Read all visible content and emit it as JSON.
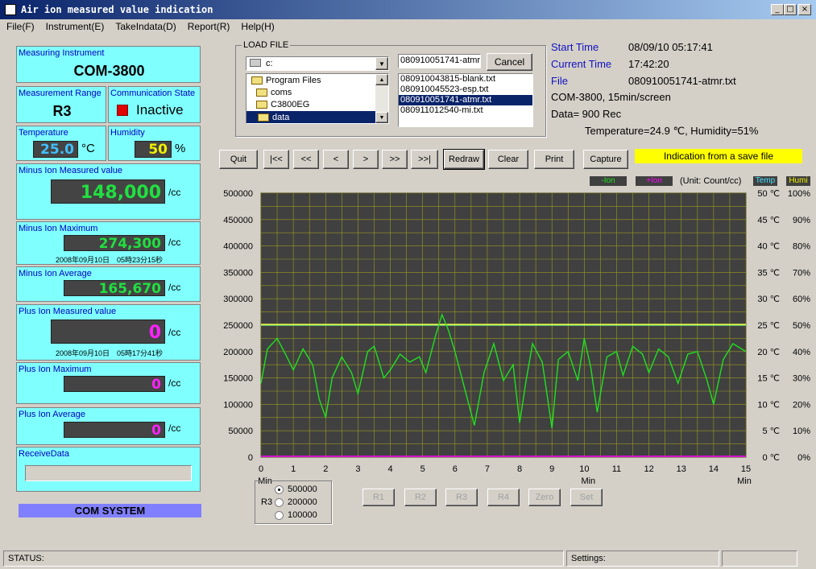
{
  "window": {
    "title": "Air ion measured value indication"
  },
  "menu": [
    "File(F)",
    "Instrument(E)",
    "TakeIndata(D)",
    "Report(R)",
    "Help(H)"
  ],
  "left": {
    "instrument_label": "Measuring Instrument",
    "instrument": "COM-3800",
    "range_label": "Measurement Range",
    "range": "R3",
    "comm_label": "Communication State",
    "comm_state": "Inactive",
    "temp_label": "Temperature",
    "temp_value": "25.0",
    "temp_unit": "°C",
    "hum_label": "Humidity",
    "hum_value": "50",
    "hum_unit": "%",
    "minus_measured_label": "Minus Ion Measured value",
    "minus_measured": "148,000",
    "minus_max_label": "Minus Ion Maximum",
    "minus_max": "274,300",
    "minus_max_time": "2008年09月10日　05時23分15秒",
    "minus_avg_label": "Minus Ion Average",
    "minus_avg": "165,670",
    "plus_measured_label": "Plus Ion Measured value",
    "plus_measured": "0",
    "plus_measured_time": "2008年09月10日　05時17分41秒",
    "plus_max_label": "Plus Ion Maximum",
    "plus_max": "0",
    "plus_avg_label": "Plus Ion Average",
    "plus_avg": "0",
    "unit": "/cc",
    "receive_label": "ReceiveData",
    "com_system": "COM SYSTEM"
  },
  "loadfile": {
    "legend": "LOAD FILE",
    "drive": "c:",
    "folders": [
      "Program Files",
      "coms",
      "C3800EG",
      "data"
    ],
    "filename_value": "080910051741-atmr.",
    "cancel": "Cancel",
    "files": [
      "080910043815-blank.txt",
      "080910045523-esp.txt",
      "080910051741-atmr.txt",
      "080911012540-mi.txt"
    ]
  },
  "info": {
    "start_label": "Start Time",
    "start": "08/09/10 05:17:41",
    "current_label": "Current Time",
    "current": "17:42:20",
    "file_label": "File",
    "file": "080910051741-atmr.txt",
    "model": "COM-3800, 15min/screen",
    "data": "Data= 900 Rec",
    "templine": "Temperature=24.9 ℃, Humidity=51%"
  },
  "toolbar": [
    "Quit",
    "|<<",
    "<<",
    "<",
    ">",
    ">>",
    ">>|",
    "Redraw",
    "Clear",
    "Print",
    "Capture"
  ],
  "indication": "Indication from a save file",
  "legend": {
    "minus": "-Ion",
    "plus": "+Ion",
    "unit": "(Unit: Count/cc)",
    "temp": "Temp",
    "humi": "Humi"
  },
  "range_group": {
    "label": "R3",
    "options": [
      "500000",
      "200000",
      "100000"
    ],
    "selected": 0
  },
  "range_buttons": [
    "R1",
    "R2",
    "R3",
    "R4",
    "Zero",
    "Set"
  ],
  "status": {
    "status_label": "STATUS:",
    "settings_label": "Settings:"
  },
  "colors": {
    "minus": "#20e020",
    "plus": "#ff00ff",
    "temp": "#ffff40",
    "hum": "#80ff80",
    "bg": "#404040",
    "grid": "#9a9a20"
  },
  "chart_data": {
    "type": "line",
    "xlabel": "Min",
    "xlim": [
      0,
      15
    ],
    "ylim": [
      0,
      500000
    ],
    "yticks": [
      "500000",
      "450000",
      "400000",
      "350000",
      "300000",
      "250000",
      "200000",
      "150000",
      "100000",
      "50000",
      "0"
    ],
    "xticks": [
      "0",
      "1",
      "2",
      "3",
      "4",
      "5",
      "6",
      "7",
      "8",
      "9",
      "10",
      "11",
      "12",
      "13",
      "14",
      "15"
    ],
    "temp_ticks": [
      "50 ℃",
      "45 ℃",
      "40 ℃",
      "35 ℃",
      "30 ℃",
      "25 ℃",
      "20 ℃",
      "15 ℃",
      "10 ℃",
      "5 ℃",
      "0 ℃"
    ],
    "hum_ticks": [
      "100%",
      "90%",
      "80%",
      "70%",
      "60%",
      "50%",
      "40%",
      "30%",
      "20%",
      "10%",
      "0%"
    ],
    "series": [
      {
        "name": "-Ion",
        "x": [
          0,
          0.2,
          0.5,
          0.8,
          1.0,
          1.3,
          1.6,
          1.8,
          2.0,
          2.2,
          2.5,
          2.8,
          3.0,
          3.3,
          3.5,
          3.8,
          4.0,
          4.3,
          4.6,
          4.9,
          5.1,
          5.4,
          5.6,
          5.8,
          6.0,
          6.3,
          6.6,
          6.9,
          7.2,
          7.5,
          7.8,
          8.0,
          8.2,
          8.4,
          8.7,
          9.0,
          9.2,
          9.5,
          9.8,
          10.0,
          10.2,
          10.4,
          10.7,
          11.0,
          11.2,
          11.5,
          11.8,
          12.0,
          12.3,
          12.6,
          12.9,
          13.2,
          13.5,
          13.8,
          14.0,
          14.3,
          14.6,
          15.0
        ],
        "values": [
          140000,
          205000,
          225000,
          190000,
          165000,
          205000,
          175000,
          110000,
          75000,
          150000,
          190000,
          160000,
          120000,
          200000,
          210000,
          150000,
          165000,
          195000,
          180000,
          190000,
          160000,
          230000,
          270000,
          240000,
          200000,
          130000,
          60000,
          160000,
          215000,
          145000,
          175000,
          65000,
          145000,
          215000,
          180000,
          55000,
          185000,
          200000,
          145000,
          225000,
          170000,
          85000,
          190000,
          200000,
          155000,
          210000,
          195000,
          160000,
          205000,
          190000,
          140000,
          195000,
          200000,
          145000,
          100000,
          185000,
          215000,
          200000
        ]
      },
      {
        "name": "+Ion",
        "x": [
          0,
          15
        ],
        "values": [
          0,
          0
        ]
      },
      {
        "name": "Temp",
        "x": [
          0,
          15
        ],
        "values": [
          25,
          25
        ]
      },
      {
        "name": "Humi",
        "x": [
          0,
          15
        ],
        "values": [
          50,
          50
        ]
      }
    ]
  }
}
